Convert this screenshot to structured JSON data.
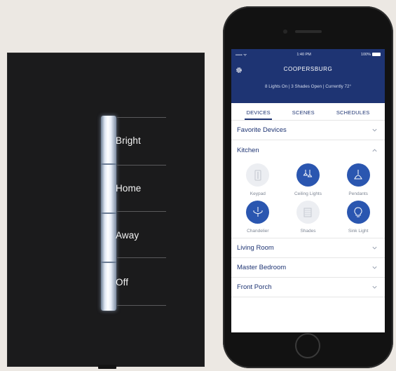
{
  "keypad": {
    "buttons": [
      {
        "label": "Bright"
      },
      {
        "label": "Home"
      },
      {
        "label": "Away"
      },
      {
        "label": "Off"
      }
    ]
  },
  "phone": {
    "status_bar": {
      "carrier": "••••• ᯤ",
      "time": "1:40 PM",
      "battery": "100%"
    },
    "header": {
      "title": "COOPERSBURG",
      "summary": "8 Lights On  |  3 Shades Open  |  Currently 72°"
    },
    "tabs": [
      {
        "label": "DEVICES",
        "active": true
      },
      {
        "label": "SCENES",
        "active": false
      },
      {
        "label": "SCHEDULES",
        "active": false
      }
    ],
    "sections": {
      "favorites": {
        "label": "Favorite Devices"
      },
      "kitchen": {
        "label": "Kitchen"
      },
      "living_room": {
        "label": "Living Room"
      },
      "master_bedroom": {
        "label": "Master Bedroom"
      },
      "front_porch": {
        "label": "Front Porch"
      }
    },
    "kitchen_devices": [
      {
        "label": "Keypad",
        "on": false,
        "icon": "keypad-icon"
      },
      {
        "label": "Ceiling Lights",
        "on": true,
        "icon": "ceiling-lights-icon"
      },
      {
        "label": "Pendants",
        "on": true,
        "icon": "pendant-icon"
      },
      {
        "label": "Chandelier",
        "on": true,
        "icon": "chandelier-icon"
      },
      {
        "label": "Shades",
        "on": false,
        "icon": "shades-icon"
      },
      {
        "label": "Sink Light",
        "on": true,
        "icon": "bulb-icon"
      }
    ],
    "colors": {
      "brand_navy": "#1e3473",
      "device_on": "#2a56b0",
      "device_off": "#eceef2"
    }
  }
}
